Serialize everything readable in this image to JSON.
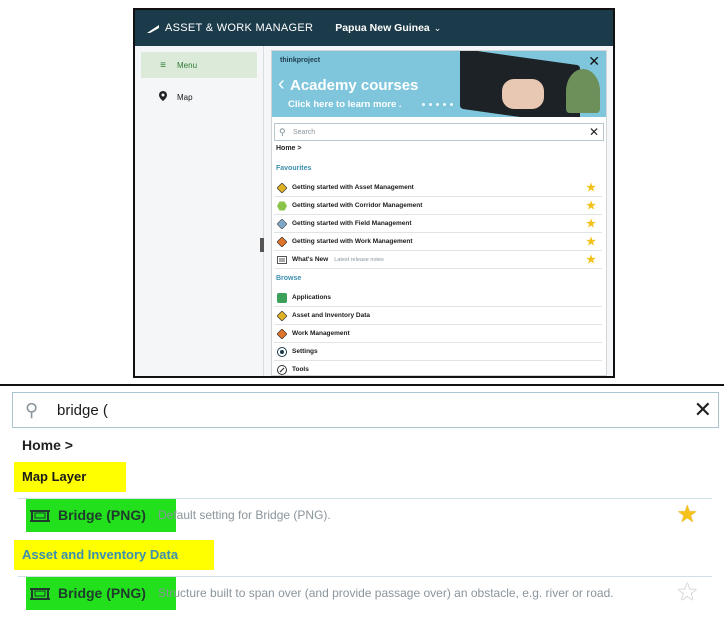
{
  "top": {
    "header": {
      "app_name": "ASSET & WORK MANAGER",
      "country": "Papua New Guinea"
    },
    "sidebar": {
      "items": [
        {
          "label": "Menu",
          "icon": "hamburger-icon",
          "active": true
        },
        {
          "label": "Map",
          "icon": "map-pin-icon",
          "active": false
        }
      ]
    },
    "banner": {
      "brand": "thinkproject",
      "title": "Academy courses",
      "subtitle": "Click here to learn more ."
    },
    "search": {
      "placeholder": "Search"
    },
    "breadcrumb": "Home >",
    "favourites": {
      "title": "Favourites",
      "items": [
        {
          "label": "Getting started with Asset Management",
          "icon": "asset-diamond-icon",
          "starred": true
        },
        {
          "label": "Getting started with Corridor Management",
          "icon": "corridor-hex-icon",
          "starred": true
        },
        {
          "label": "Getting started with Field Management",
          "icon": "field-diamond-icon",
          "starred": true
        },
        {
          "label": "Getting started with Work Management",
          "icon": "work-diamond-icon",
          "starred": true
        },
        {
          "label": "What's New",
          "note": "Latest release notes",
          "icon": "news-icon",
          "starred": true
        }
      ]
    },
    "browse": {
      "title": "Browse",
      "items": [
        {
          "label": "Applications",
          "icon": "applications-icon"
        },
        {
          "label": "Asset and Inventory Data",
          "icon": "asset-diamond-icon"
        },
        {
          "label": "Work Management",
          "icon": "work-diamond-icon"
        },
        {
          "label": "Settings",
          "icon": "gear-icon"
        },
        {
          "label": "Tools",
          "icon": "tools-icon"
        }
      ]
    }
  },
  "bottom": {
    "search": {
      "value": "bridge ("
    },
    "breadcrumb": "Home >",
    "sections": [
      {
        "title": "Map Layer",
        "result": {
          "label": "Bridge (PNG)",
          "description": "Default setting for Bridge (PNG).",
          "starred": true
        }
      },
      {
        "title": "Asset and Inventory Data",
        "result": {
          "label": "Bridge (PNG)",
          "description": "Structure built to span over (and provide passage over) an obstacle, e.g. river or road.",
          "starred": false
        }
      }
    ]
  },
  "colors": {
    "header": "#1c3b4a",
    "section": "#3b8fb0",
    "highlight_yellow": "#ffff00",
    "highlight_green": "#22e01c",
    "star": "#f6c21a"
  }
}
